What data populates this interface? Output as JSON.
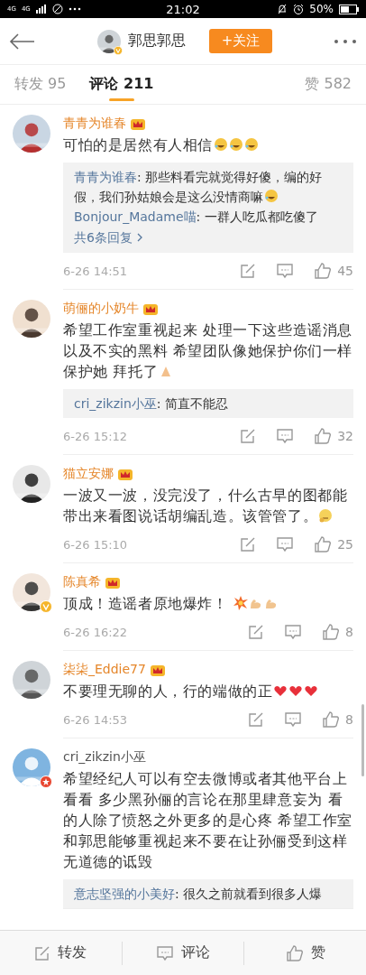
{
  "status_bar": {
    "networks": [
      "4G",
      "4G"
    ],
    "time": "21:02",
    "battery": "50%"
  },
  "header": {
    "title": "郭思郭思",
    "avatar_badge": {
      "kind": "verified"
    },
    "follow_button": "+关注"
  },
  "tabs": [
    {
      "label": "转发 95",
      "selected": false
    },
    {
      "label": "评论 211",
      "selected": true
    },
    {
      "label": "赞 582",
      "selected": false
    }
  ],
  "comments": [
    {
      "name": "青青为谁春",
      "vip": true,
      "text": "可怕的是居然有人相信",
      "emoji": [
        {
          "kind": "laugh"
        },
        {
          "kind": "laugh"
        },
        {
          "kind": "laugh"
        }
      ],
      "replies": [
        {
          "user": "青青为谁春",
          "text": ": 那些料看完就觉得好傻，编的好假，我们孙姑娘会是这么没情商嘛",
          "emoji": [
            {
              "kind": "laugh"
            }
          ]
        },
        {
          "user": "Bonjour_Madame喵",
          "text": ": 一群人吃瓜都吃傻了"
        }
      ],
      "more_replies": "共6条回复",
      "time": "6-26 14:51",
      "likes": "45"
    },
    {
      "name": "萌俪的小奶牛",
      "vip": true,
      "text": "希望工作室重视起来  处理一下这些造谣消息以及不实的黑料   希望团队像她保护你们一样保护她 拜托了",
      "emoji": [
        {
          "kind": "pray"
        }
      ],
      "replies": [
        {
          "user": "cri_zikzin小巫",
          "text": ": 简直不能忍"
        }
      ],
      "time": "6-26 15:12",
      "likes": "32"
    },
    {
      "name": "猫立安娜",
      "vip": true,
      "text": "一波又一波，没完没了，什么古早的图都能带出来看图说话胡编乱造。该管管了。",
      "emoji": [
        {
          "kind": "think"
        }
      ],
      "time": "6-26 15:10",
      "likes": "25"
    },
    {
      "name": "陈真希",
      "vip": true,
      "avatar_badge": {
        "kind": "verified"
      },
      "text": "顶成！造谣者原地爆炸！ ",
      "emoji": [
        {
          "kind": "boom"
        },
        {
          "kind": "muscle"
        },
        {
          "kind": "muscle"
        }
      ],
      "time": "6-26 16:22",
      "likes": "8"
    },
    {
      "name": "柒柒_Eddie77",
      "vip": true,
      "text": "不要理无聊的人，行的端做的正",
      "emoji": [
        {
          "kind": "heart"
        },
        {
          "kind": "heart"
        },
        {
          "kind": "heart"
        }
      ],
      "time": "6-26 14:53",
      "likes": "8"
    },
    {
      "name": "cri_zikzin小巫",
      "vip": false,
      "avatar_badge": {
        "kind": "star"
      },
      "text": "希望经纪人可以有空去微博或者其他平台上看看 多少黑孙俪的言论在那里肆意妄为 看的人除了愤怒之外更多的是心疼 希望工作室和郭思能够重视起来不要在让孙俪受到这样无道德的诋毁",
      "replies": [
        {
          "user": "意志坚强的小美好",
          "text": ": 很久之前就看到很多人爆"
        }
      ]
    }
  ],
  "bottom_bar": [
    {
      "kind": "repost",
      "label": "转发"
    },
    {
      "kind": "comment",
      "label": "评论"
    },
    {
      "kind": "like",
      "label": "赞"
    }
  ]
}
